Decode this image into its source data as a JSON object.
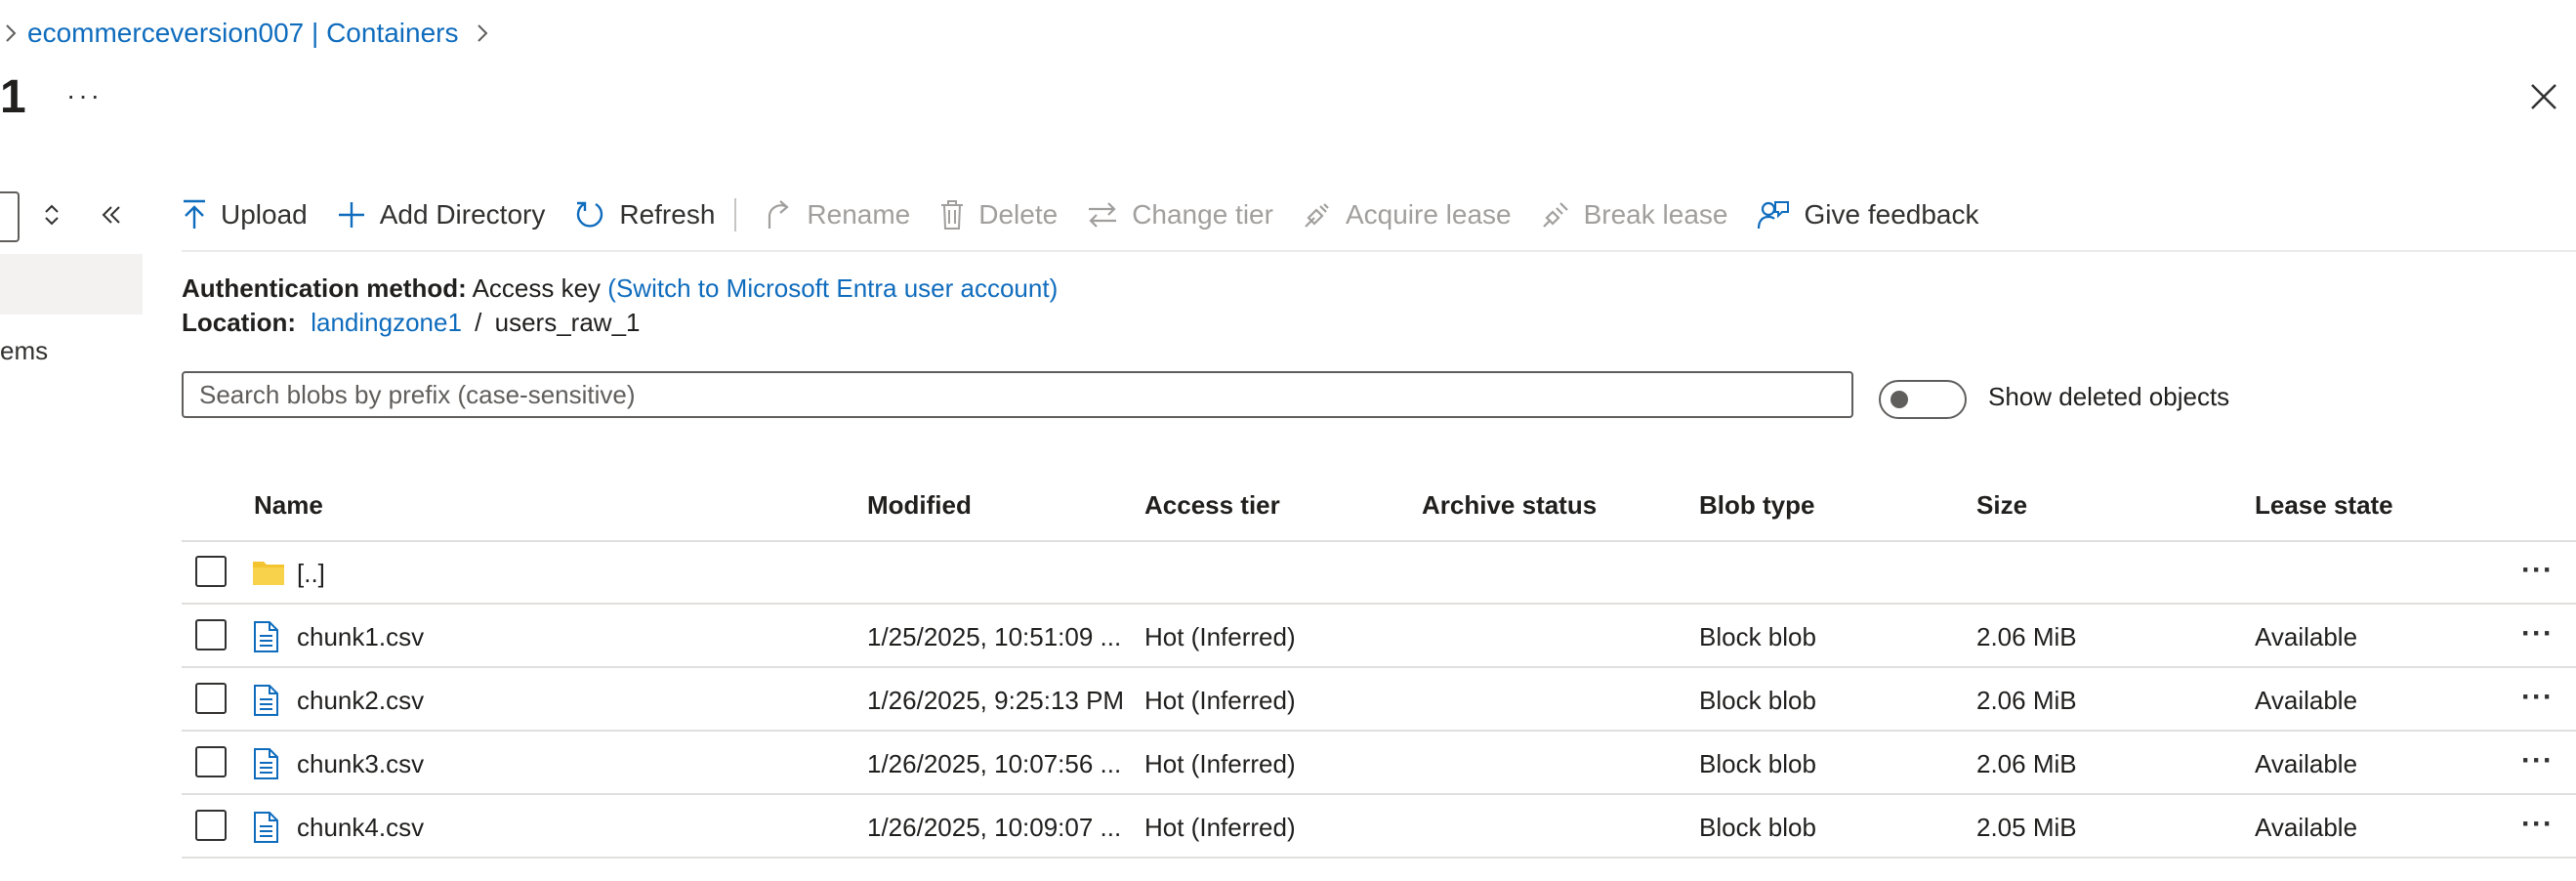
{
  "breadcrumb": {
    "items": [
      "ecommerceversion007 | Containers"
    ]
  },
  "page": {
    "title": "1",
    "more_label": "···"
  },
  "left_nav": {
    "partial_text": "ems"
  },
  "toolbar": {
    "upload": "Upload",
    "add_directory": "Add Directory",
    "refresh": "Refresh",
    "rename": "Rename",
    "delete": "Delete",
    "change_tier": "Change tier",
    "acquire_lease": "Acquire lease",
    "break_lease": "Break lease",
    "give_feedback": "Give feedback"
  },
  "auth": {
    "label": "Authentication method:",
    "value": "Access key",
    "switch_link": "(Switch to Microsoft Entra user account)"
  },
  "location": {
    "label": "Location:",
    "container_link": "landingzone1",
    "separator": "/",
    "path": "users_raw_1"
  },
  "search": {
    "placeholder": "Search blobs by prefix (case-sensitive)",
    "value": ""
  },
  "show_deleted": {
    "label": "Show deleted objects",
    "enabled": false
  },
  "table": {
    "columns": [
      "Name",
      "Modified",
      "Access tier",
      "Archive status",
      "Blob type",
      "Size",
      "Lease state"
    ],
    "parent_row": {
      "name": "[..]"
    },
    "rows": [
      {
        "name": "chunk1.csv",
        "modified": "1/25/2025, 10:51:09 ...",
        "access_tier": "Hot (Inferred)",
        "archive_status": "",
        "blob_type": "Block blob",
        "size": "2.06 MiB",
        "lease_state": "Available"
      },
      {
        "name": "chunk2.csv",
        "modified": "1/26/2025, 9:25:13 PM",
        "access_tier": "Hot (Inferred)",
        "archive_status": "",
        "blob_type": "Block blob",
        "size": "2.06 MiB",
        "lease_state": "Available"
      },
      {
        "name": "chunk3.csv",
        "modified": "1/26/2025, 10:07:56 ...",
        "access_tier": "Hot (Inferred)",
        "archive_status": "",
        "blob_type": "Block blob",
        "size": "2.06 MiB",
        "lease_state": "Available"
      },
      {
        "name": "chunk4.csv",
        "modified": "1/26/2025, 10:09:07 ...",
        "access_tier": "Hot (Inferred)",
        "archive_status": "",
        "blob_type": "Block blob",
        "size": "2.05 MiB",
        "lease_state": "Available"
      }
    ],
    "row_more_label": "···"
  },
  "colors": {
    "link": "#0f6cbd",
    "folder": "#f4c430",
    "file_icon": "#0f6cbd",
    "disabled": "#a19f9d"
  },
  "icons": {
    "breadcrumb_separator": "chevron-right-icon",
    "folder": "folder-icon",
    "file": "document-icon",
    "close": "close-icon"
  }
}
